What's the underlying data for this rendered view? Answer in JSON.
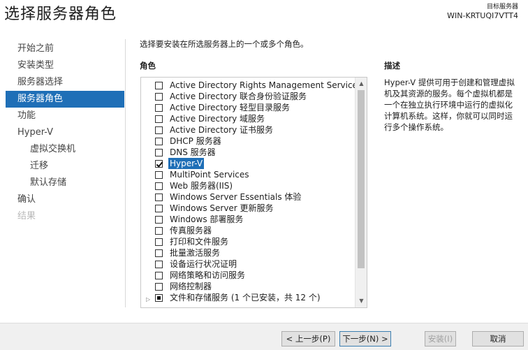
{
  "header": {
    "title": "选择服务器角色",
    "target_label": "目标服务器",
    "target_server": "WIN-KRTUQI7VTT4"
  },
  "nav": [
    {
      "label": "开始之前",
      "state": "normal"
    },
    {
      "label": "安装类型",
      "state": "normal"
    },
    {
      "label": "服务器选择",
      "state": "normal"
    },
    {
      "label": "服务器角色",
      "state": "active"
    },
    {
      "label": "功能",
      "state": "normal"
    },
    {
      "label": "Hyper-V",
      "state": "normal"
    },
    {
      "label": "虚拟交换机",
      "state": "sub"
    },
    {
      "label": "迁移",
      "state": "sub"
    },
    {
      "label": "默认存储",
      "state": "sub"
    },
    {
      "label": "确认",
      "state": "normal"
    },
    {
      "label": "结果",
      "state": "disabled"
    }
  ],
  "main": {
    "instruction": "选择要安装在所选服务器上的一个或多个角色。",
    "roles_header": "角色",
    "roles": [
      {
        "label": "Active Directory Rights Management Services",
        "checked": false
      },
      {
        "label": "Active Directory 联合身份验证服务",
        "checked": false
      },
      {
        "label": "Active Directory 轻型目录服务",
        "checked": false
      },
      {
        "label": "Active Directory 域服务",
        "checked": false
      },
      {
        "label": "Active Directory 证书服务",
        "checked": false
      },
      {
        "label": "DHCP 服务器",
        "checked": false
      },
      {
        "label": "DNS 服务器",
        "checked": false
      },
      {
        "label": "Hyper-V",
        "checked": true,
        "selected": true
      },
      {
        "label": "MultiPoint Services",
        "checked": false
      },
      {
        "label": "Web 服务器(IIS)",
        "checked": false
      },
      {
        "label": "Windows Server Essentials 体验",
        "checked": false
      },
      {
        "label": "Windows Server 更新服务",
        "checked": false
      },
      {
        "label": "Windows 部署服务",
        "checked": false
      },
      {
        "label": "传真服务器",
        "checked": false
      },
      {
        "label": "打印和文件服务",
        "checked": false
      },
      {
        "label": "批量激活服务",
        "checked": false
      },
      {
        "label": "设备运行状况证明",
        "checked": false
      },
      {
        "label": "网络策略和访问服务",
        "checked": false
      },
      {
        "label": "网络控制器",
        "checked": false
      },
      {
        "label": "文件和存储服务 (1 个已安装，共 12 个)",
        "checked": "partial",
        "expandable": true
      }
    ],
    "description_header": "描述",
    "description": "Hyper-V 提供可用于创建和管理虚拟机及其资源的服务。每个虚拟机都是一个在独立执行环境中运行的虚拟化计算机系统。这样，你就可以同时运行多个操作系统。"
  },
  "footer": {
    "prev": "< 上一步(P)",
    "next": "下一步(N) >",
    "install": "安装(I)",
    "cancel": "取消"
  },
  "colors": {
    "accent": "#1f6fb7",
    "footer_bg": "#f0f0f0"
  }
}
